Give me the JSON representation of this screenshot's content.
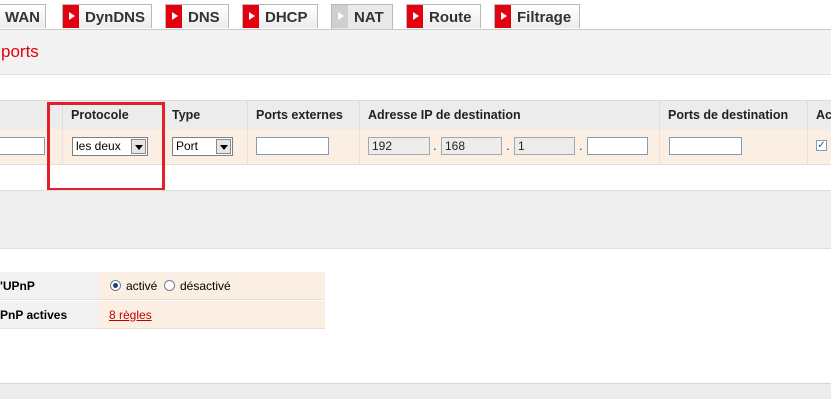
{
  "tabs": [
    {
      "label": "WAN",
      "active": false,
      "marker": false
    },
    {
      "label": "DynDNS",
      "active": false,
      "marker": true
    },
    {
      "label": "DNS",
      "active": false,
      "marker": true
    },
    {
      "label": "DHCP",
      "active": false,
      "marker": true
    },
    {
      "label": "NAT",
      "active": true,
      "marker": true
    },
    {
      "label": "Route",
      "active": false,
      "marker": true
    },
    {
      "label": "Filtrage",
      "active": false,
      "marker": true
    }
  ],
  "section": {
    "title": "ports"
  },
  "table": {
    "headers": {
      "protocole": "Protocole",
      "type": "Type",
      "ports_externes": "Ports externes",
      "adresse_ip": "Adresse IP de destination",
      "ports_destination": "Ports de destination",
      "actif": "Ac"
    },
    "row": {
      "protocole": "les deux",
      "type": "Port",
      "ports_externes": "",
      "ip": [
        "192",
        "168",
        "1",
        ""
      ],
      "ports_destination": "",
      "actif_checked": true
    }
  },
  "upnp": {
    "label1": "'UPnP",
    "radio_on": "activé",
    "radio_off": "désactivé",
    "label2": "PnP actives",
    "rules_link": "8 règles"
  },
  "colors": {
    "accent": "#e3000f",
    "row_bg": "#fbefe3",
    "highlight": "#e3202a"
  },
  "icons": {
    "tab_marker": "play-arrow-icon",
    "dropdown": "chevron-down-icon",
    "checkbox": "check-icon"
  }
}
